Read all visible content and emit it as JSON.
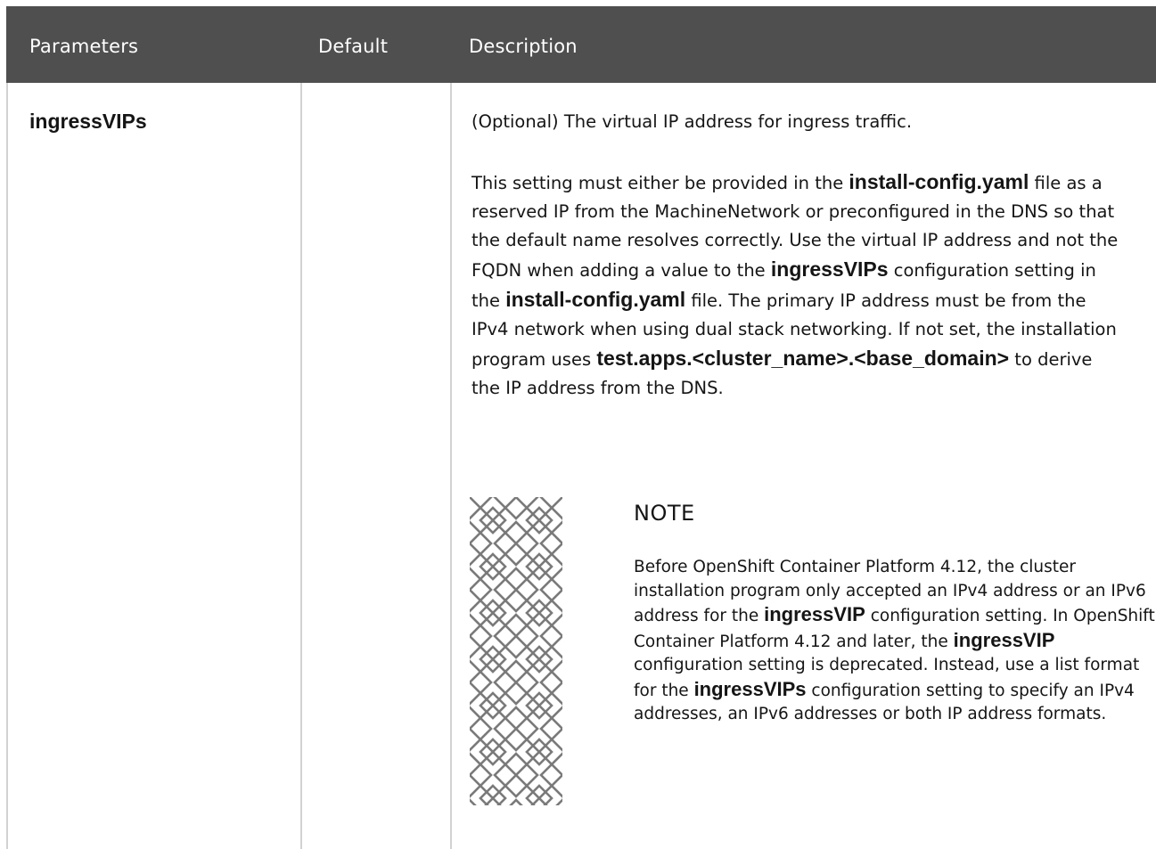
{
  "header": {
    "col_parameters": "Parameters",
    "col_default": "Default",
    "col_description": "Description"
  },
  "row": {
    "parameter": "ingressVIPs",
    "default": "",
    "description": {
      "p1": "(Optional) The virtual IP address for ingress traffic.",
      "p2": {
        "t1": "This setting must either be provided in the ",
        "b1": "install-config.yaml",
        "t2": " file as a reserved IP from the MachineNetwork or preconfigured in the DNS so that the default name resolves correctly. Use the virtual IP address and not the FQDN when adding a value to the ",
        "b2": "ingressVIPs",
        "t3": " configuration setting in the ",
        "b3": "install-config.yaml",
        "t4": " file. The primary IP address must be from the IPv4 network when using dual stack networking. If not set, the installation program uses ",
        "b4": "test.apps.<cluster_name>.<base_domain>",
        "t5": " to derive the IP address from the DNS."
      }
    },
    "note": {
      "icon": "note-pattern-icon",
      "title": "NOTE",
      "t1": "Before OpenShift Container Platform 4.12, the cluster installation program only accepted an IPv4 address or an IPv6 address for the ",
      "b1": "ingressVIP",
      "t2": " configuration setting. In OpenShift Container Platform 4.12 and later, the ",
      "b2": "ingressVIP",
      "t3": " configuration setting is deprecated. Instead, use a list format for the ",
      "b3": "ingressVIPs",
      "t4": " configuration setting to specify an IPv4 addresses, an IPv6 addresses or both IP address formats."
    }
  }
}
